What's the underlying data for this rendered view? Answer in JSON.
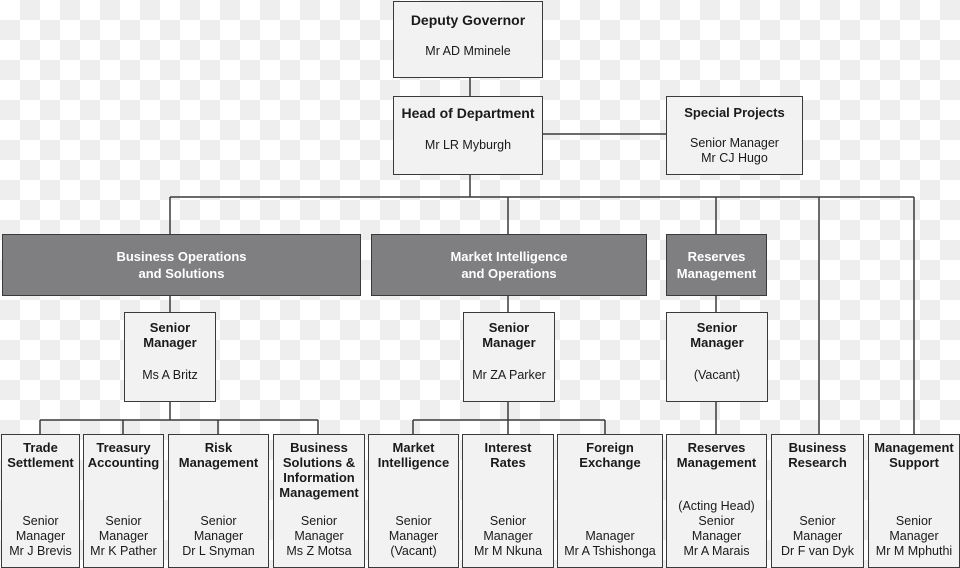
{
  "colors": {
    "box_fill": "#f2f2f2",
    "division_fill": "#7f7f82",
    "border": "#3a3a3a",
    "division_text": "#ffffff"
  },
  "boxes": [
    {
      "id": "deputy-governor",
      "title": [
        "Deputy Governor"
      ],
      "sub": [
        "Mr AD Mminele"
      ]
    },
    {
      "id": "head-of-department",
      "title": [
        "Head of Department"
      ],
      "sub": [
        "Mr LR Myburgh"
      ]
    },
    {
      "id": "special-projects",
      "title": [
        "Special Projects"
      ],
      "sub": [
        "Senior Manager",
        "Mr CJ Hugo"
      ]
    },
    {
      "id": "division-business-operations",
      "title": [
        "Business Operations",
        "and Solutions"
      ],
      "sub": []
    },
    {
      "id": "division-market-intelligence",
      "title": [
        "Market Intelligence",
        "and Operations"
      ],
      "sub": []
    },
    {
      "id": "division-reserves-management",
      "title": [
        "Reserves",
        "Management"
      ],
      "sub": []
    },
    {
      "id": "senior-manager-bos",
      "title": [
        "Senior",
        "Manager"
      ],
      "sub": [
        "Ms A Britz"
      ]
    },
    {
      "id": "senior-manager-mio",
      "title": [
        "Senior",
        "Manager"
      ],
      "sub": [
        "Mr ZA Parker"
      ]
    },
    {
      "id": "senior-manager-rm",
      "title": [
        "Senior",
        "Manager"
      ],
      "sub": [
        "(Vacant)"
      ]
    },
    {
      "id": "trade-settlement",
      "title": [
        "Trade",
        "Settlement"
      ],
      "sub": [
        "Senior",
        "Manager",
        "Mr J Brevis"
      ]
    },
    {
      "id": "treasury-accounting",
      "title": [
        "Treasury",
        "Accounting"
      ],
      "sub": [
        "Senior",
        "Manager",
        "Mr K Pather"
      ]
    },
    {
      "id": "risk-management",
      "title": [
        "Risk",
        "Management"
      ],
      "sub": [
        "Senior",
        "Manager",
        "Dr L Snyman"
      ]
    },
    {
      "id": "business-solutions",
      "title": [
        "Business",
        "Solutions &",
        "Information",
        "Management"
      ],
      "sub": [
        "Senior",
        "Manager",
        "Ms Z Motsa"
      ]
    },
    {
      "id": "market-intelligence",
      "title": [
        "Market",
        "Intelligence"
      ],
      "sub": [
        "Senior",
        "Manager",
        "(Vacant)"
      ]
    },
    {
      "id": "interest-rates",
      "title": [
        "Interest",
        "Rates"
      ],
      "sub": [
        "Senior",
        "Manager",
        "Mr M Nkuna"
      ]
    },
    {
      "id": "foreign-exchange",
      "title": [
        "Foreign",
        "Exchange"
      ],
      "sub": [
        "Manager",
        "Mr A Tshishonga"
      ]
    },
    {
      "id": "reserves-management",
      "title": [
        "Reserves",
        "Management"
      ],
      "sub": [
        "(Acting Head)",
        "Senior",
        "Manager",
        "Mr A Marais"
      ]
    },
    {
      "id": "business-research",
      "title": [
        "Business",
        "Research"
      ],
      "sub": [
        "Senior",
        "Manager",
        "Dr F van Dyk"
      ]
    },
    {
      "id": "management-support",
      "title": [
        "Management",
        "Support"
      ],
      "sub": [
        "Senior",
        "Manager",
        "Mr M Mphuthi"
      ]
    }
  ]
}
